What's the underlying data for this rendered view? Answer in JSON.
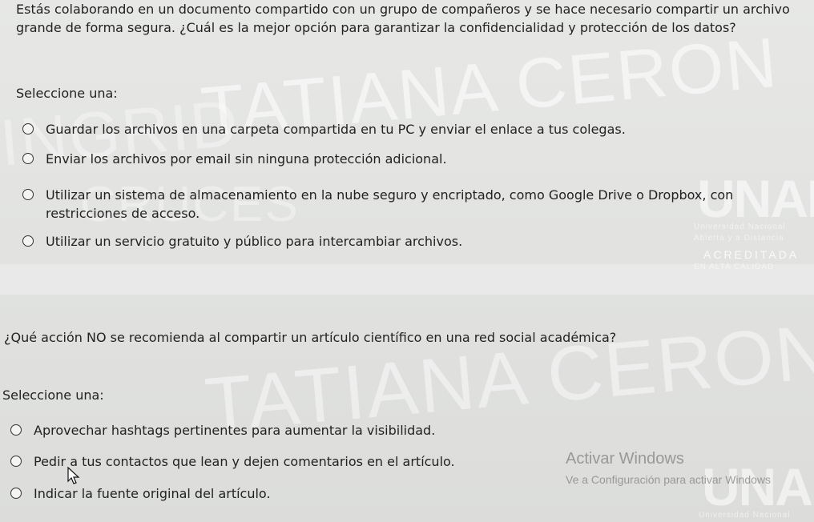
{
  "watermark": {
    "name_large": "TATIANA CERON",
    "name_left": "INGRID",
    "name_mid": "CRUCES",
    "name_bottom": "TATIANA CERON"
  },
  "logo": {
    "letters": "UNAD",
    "line1": "Universidad Nacional",
    "line2": "Abierta y a Distancia",
    "accredit": "ACREDITADA",
    "accredit_sub": "EN ALTA CALIDAD"
  },
  "questions": [
    {
      "text": "Estás colaborando en un documento compartido con un grupo de compañeros y se hace necesario compartir un archivo grande de forma segura. ¿Cuál es la mejor opción para garantizar la confidencialidad y protección de los datos?",
      "prompt": "Seleccione una:",
      "options": [
        "Guardar los archivos en una carpeta compartida en tu PC y enviar el enlace a tus colegas.",
        "Enviar los archivos por email sin ninguna protección adicional.",
        "Utilizar un sistema de almacenamiento en la nube seguro y encriptado, como Google Drive o Dropbox, con restricciones de acceso.",
        "Utilizar un servicio gratuito y público para intercambiar archivos."
      ]
    },
    {
      "text": "¿Qué acción NO se recomienda al compartir un artículo científico en una red social académica?",
      "prompt": "Seleccione una:",
      "options": [
        "Aprovechar hashtags pertinentes para aumentar la visibilidad.",
        "Pedir a tus contactos que lean y dejen comentarios en el artículo.",
        "Indicar la fuente original del artículo."
      ]
    }
  ],
  "windows_activation": {
    "title": "Activar Windows",
    "subtitle": "Ve a Configuración para activar Windows"
  }
}
